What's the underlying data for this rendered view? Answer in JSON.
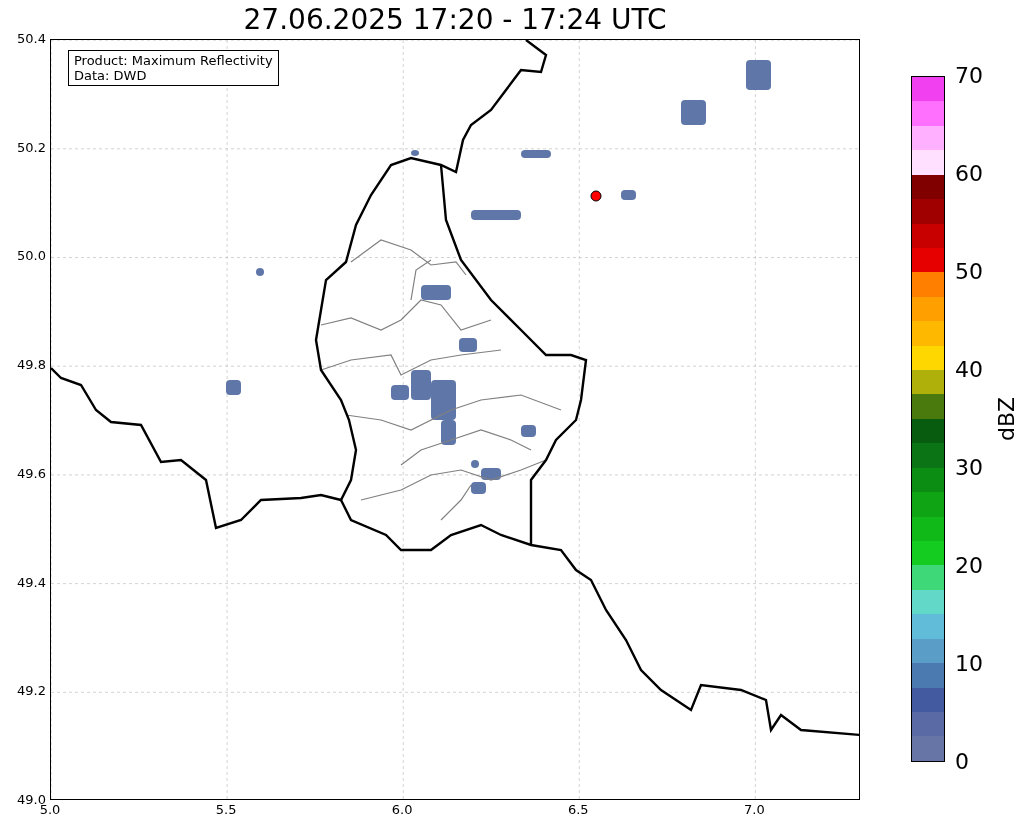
{
  "title": "27.06.2025 17:20 - 17:24 UTC",
  "legend_box": {
    "lines": [
      "Product: Maximum Reflectivity",
      "Data: DWD"
    ]
  },
  "map": {
    "x_ticks": [
      "5.0",
      "5.5",
      "6.0",
      "6.5",
      "7.0"
    ],
    "y_ticks": [
      "50.4",
      "50.2",
      "50.0",
      "49.8",
      "49.6",
      "49.4",
      "49.2",
      "49.0"
    ]
  },
  "colorbar": {
    "label": "dBZ",
    "ticks": [
      "70",
      "60",
      "50",
      "40",
      "30",
      "20",
      "10",
      "0"
    ],
    "segments": [
      {
        "color": "#f040f0"
      },
      {
        "color": "#ff70ff"
      },
      {
        "color": "#ffb0ff"
      },
      {
        "color": "#ffe0ff"
      },
      {
        "color": "#800000"
      },
      {
        "color": "#a00000"
      },
      {
        "color": "#c80000"
      },
      {
        "color": "#e60000"
      },
      {
        "color": "#ff8000"
      },
      {
        "color": "#ffa000"
      },
      {
        "color": "#ffb800"
      },
      {
        "color": "#ffd700"
      },
      {
        "color": "#b0b00a"
      },
      {
        "color": "#4a7a0e"
      },
      {
        "color": "#085c10"
      },
      {
        "color": "#0b7414"
      },
      {
        "color": "#0b8c12"
      },
      {
        "color": "#0ea414"
      },
      {
        "color": "#10b818"
      },
      {
        "color": "#14cc20"
      },
      {
        "color": "#3fd878"
      },
      {
        "color": "#62d8c8"
      },
      {
        "color": "#60bcd8"
      },
      {
        "color": "#5a9ec8"
      },
      {
        "color": "#4a7ab0"
      },
      {
        "color": "#435aa0"
      },
      {
        "color": "#5a6aa4"
      },
      {
        "color": "#6674a6"
      }
    ]
  }
}
